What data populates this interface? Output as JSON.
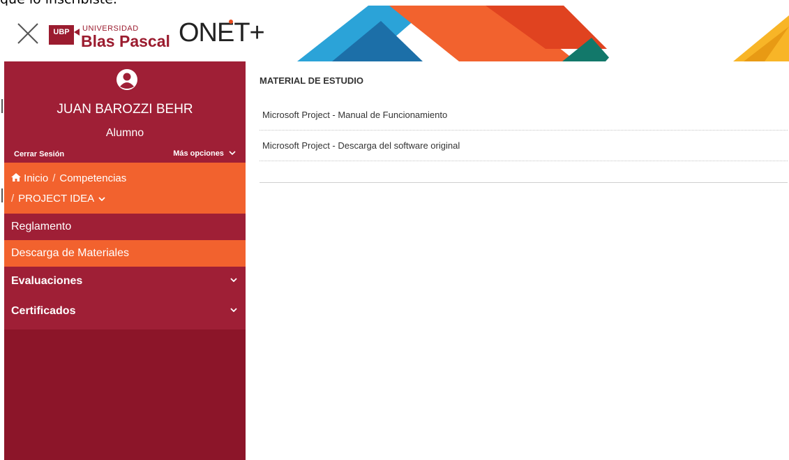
{
  "top_cut_text": "que lo inscribiste.",
  "header": {
    "ubp_badge": "UBP",
    "university_small": "UNIVERSIDAD",
    "university_name": "Blas Pascal",
    "platform_name": "ONET+"
  },
  "profile": {
    "user_name": "JUAN BAROZZI BEHR",
    "role": "Alumno",
    "logout_label": "Cerrar Sesión",
    "more_options_label": "Más opciones"
  },
  "breadcrumb": {
    "home_label": "Inicio",
    "section_label": "Competencias",
    "course_label": "PROJECT IDEA"
  },
  "nav": {
    "items": [
      {
        "label": "Reglamento",
        "expandable": false,
        "active": false
      },
      {
        "label": "Descarga de Materiales",
        "expandable": false,
        "active": true
      },
      {
        "label": "Evaluaciones",
        "expandable": true,
        "active": false
      },
      {
        "label": "Certificados",
        "expandable": true,
        "active": false
      }
    ]
  },
  "main": {
    "title": "MATERIAL DE ESTUDIO",
    "files": [
      "Microsoft Project - Manual de Funcionamiento",
      "Microsoft Project - Descarga del software original"
    ]
  },
  "colors": {
    "sidebar_dark": "#8c1529",
    "sidebar": "#9f1f36",
    "accent_orange": "#f2622e"
  }
}
